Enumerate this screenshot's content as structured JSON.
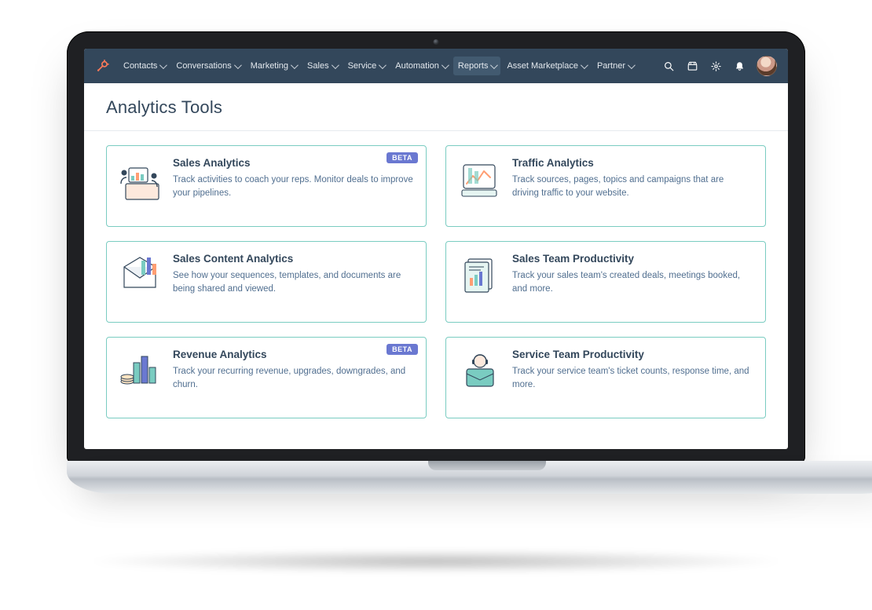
{
  "brand": "HubSpot",
  "nav": {
    "items": [
      {
        "label": "Contacts",
        "active": false
      },
      {
        "label": "Conversations",
        "active": false
      },
      {
        "label": "Marketing",
        "active": false
      },
      {
        "label": "Sales",
        "active": false
      },
      {
        "label": "Service",
        "active": false
      },
      {
        "label": "Automation",
        "active": false
      },
      {
        "label": "Reports",
        "active": true
      },
      {
        "label": "Asset Marketplace",
        "active": false
      },
      {
        "label": "Partner",
        "active": false
      }
    ]
  },
  "page": {
    "title": "Analytics Tools"
  },
  "badges": {
    "beta": "BETA"
  },
  "cards": [
    {
      "id": "sales-analytics",
      "title": "Sales Analytics",
      "desc": "Track activities to coach your reps. Monitor deals to improve your pipelines.",
      "badge": "beta",
      "icon": "presentation-chart-icon"
    },
    {
      "id": "traffic-analytics",
      "title": "Traffic Analytics",
      "desc": "Track sources, pages, topics and campaigns that are driving traffic to your website.",
      "badge": null,
      "icon": "line-chart-icon"
    },
    {
      "id": "sales-content-analytics",
      "title": "Sales Content Analytics",
      "desc": "See how your sequences, templates, and documents are being shared and viewed.",
      "badge": null,
      "icon": "envelope-chart-icon"
    },
    {
      "id": "sales-team-productivity",
      "title": "Sales Team Productivity",
      "desc": "Track your sales team's created deals, meetings booked, and more.",
      "badge": null,
      "icon": "report-stack-icon"
    },
    {
      "id": "revenue-analytics",
      "title": "Revenue Analytics",
      "desc": "Track your recurring revenue, upgrades, downgrades, and churn.",
      "badge": "beta",
      "icon": "coins-bars-icon"
    },
    {
      "id": "service-team-productivity",
      "title": "Service Team Productivity",
      "desc": "Track your service team's ticket counts, response time, and more.",
      "badge": null,
      "icon": "headset-box-icon"
    }
  ]
}
